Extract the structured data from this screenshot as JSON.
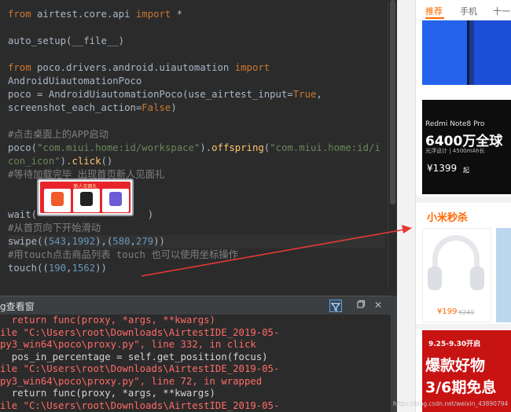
{
  "editor": {
    "lines": [
      [
        {
          "t": "from",
          "c": "kw"
        },
        {
          "t": " airtest.core.api ",
          "c": "fn"
        },
        {
          "t": "import",
          "c": "kw"
        },
        {
          "t": " *",
          "c": "fn"
        }
      ],
      [],
      [
        {
          "t": "auto_setup(__file__)",
          "c": "fn"
        }
      ],
      [],
      [
        {
          "t": "from",
          "c": "kw"
        },
        {
          "t": " poco.drivers.android.uiautomation ",
          "c": "fn"
        },
        {
          "t": "import",
          "c": "kw"
        }
      ],
      [
        {
          "t": "AndroidUiautomationPoco",
          "c": "fn"
        }
      ],
      [
        {
          "t": "poco = AndroidUiautomationPoco(use_airtest_input=",
          "c": "fn"
        },
        {
          "t": "True",
          "c": "kwv"
        },
        {
          "t": ",",
          "c": "fn"
        }
      ],
      [
        {
          "t": "screenshot_each_action=",
          "c": "fn"
        },
        {
          "t": "False",
          "c": "kwv"
        },
        {
          "t": ")",
          "c": "fn"
        }
      ],
      [],
      [
        {
          "t": "#点击桌面上的APP启动",
          "c": "cm"
        }
      ],
      [
        {
          "t": "poco(",
          "c": "fn"
        },
        {
          "t": "\"com.miui.home:id/workspace\"",
          "c": "str"
        },
        {
          "t": ").",
          "c": "fn"
        },
        {
          "t": "offspring",
          "c": "attr"
        },
        {
          "t": "(",
          "c": "fn"
        },
        {
          "t": "\"com.miui.home:id/i",
          "c": "str"
        }
      ],
      [
        {
          "t": "con_icon\"",
          "c": "str"
        },
        {
          "t": ").",
          "c": "fn"
        },
        {
          "t": "click",
          "c": "attr"
        },
        {
          "t": "()",
          "c": "fn"
        }
      ],
      [
        {
          "t": "#等待加载完毕 出现首页新人见面礼",
          "c": "cm"
        }
      ],
      [],
      [],
      [
        {
          "t": "wait(",
          "c": "fn"
        },
        {
          "t": "                   ",
          "c": "fn"
        },
        {
          "t": ")",
          "c": "fn"
        }
      ],
      [
        {
          "t": "#从首页向下开始滑动",
          "c": "cm"
        }
      ],
      [
        {
          "t": "swipe((",
          "c": "fn"
        },
        {
          "t": "543",
          "c": "num"
        },
        {
          "t": ",",
          "c": "fn"
        },
        {
          "t": "1992",
          "c": "num"
        },
        {
          "t": "),(",
          "c": "fn"
        },
        {
          "t": "580",
          "c": "num"
        },
        {
          "t": ",",
          "c": "fn"
        },
        {
          "t": "279",
          "c": "num"
        },
        {
          "t": "))",
          "c": "fn"
        }
      ],
      [
        {
          "t": "#用touch点击商品列表 touch 也可以使用坐标操作",
          "c": "cm"
        }
      ],
      [
        {
          "t": "touch((",
          "c": "fn"
        },
        {
          "t": "190",
          "c": "num"
        },
        {
          "t": ",",
          "c": "fn"
        },
        {
          "t": "1562",
          "c": "num"
        },
        {
          "t": "))",
          "c": "fn"
        }
      ]
    ],
    "highlight_line": 17,
    "thumbnail": {
      "title": "新人见面礼",
      "card_colors": [
        "#f15a29",
        "#222222",
        "#6b5bd6"
      ]
    }
  },
  "console": {
    "title": "g查看窗",
    "lines": [
      [
        {
          "t": "  return func(proxy, *args, **kwargs)",
          "c": "err"
        }
      ],
      [
        {
          "t": "ile \"C:\\Users\\root\\Downloads\\AirtestIDE_2019-05-",
          "c": "path"
        }
      ],
      [
        {
          "t": "py3_win64\\poco\\proxy.py\", line 332, in click",
          "c": "path"
        }
      ],
      [
        {
          "t": "  pos_in_percentage = self.get_position(focus)",
          "c": "norm"
        }
      ],
      [
        {
          "t": "ile \"C:\\Users\\root\\Downloads\\AirtestIDE_2019-05-",
          "c": "path"
        }
      ],
      [
        {
          "t": "py3_win64\\poco\\proxy.py\", line 72, in wrapped",
          "c": "path"
        }
      ],
      [
        {
          "t": "  return func(proxy, *args, **kwargs)",
          "c": "norm"
        }
      ],
      [
        {
          "t": "ile \"C:\\Users\\root\\Downloads\\AirtestIDE_2019-05-",
          "c": "path"
        }
      ]
    ],
    "restore_icon": "restore-window-icon",
    "close_label": "✕",
    "filter_icon": "filter-icon"
  },
  "phone": {
    "tabs": [
      "推荐",
      "手机",
      "十一"
    ],
    "active_tab": 0,
    "banner2": {
      "brand": "Redmi Note8 Pro",
      "headline": "6400万全球",
      "spec": "光浮设计 | 4500mAh长",
      "price": "¥1399",
      "price_suffix": "起"
    },
    "flash_sale_title": "小米秒杀",
    "flash_price": "¥199",
    "flash_old_price": "¥249",
    "banner3": {
      "date": "9.25-9.30开启",
      "line1": "爆款好物",
      "line2": "3/6期免息"
    }
  },
  "watermark": "https://blog.csdn.net/weixin_43890794",
  "colors": {
    "editor_bg": "#2b2b2b",
    "keyword": "#cc7832",
    "string": "#6a8759",
    "number": "#6897bb",
    "comment": "#808080",
    "accent": "#ff6700",
    "arrow": "#e53935"
  }
}
